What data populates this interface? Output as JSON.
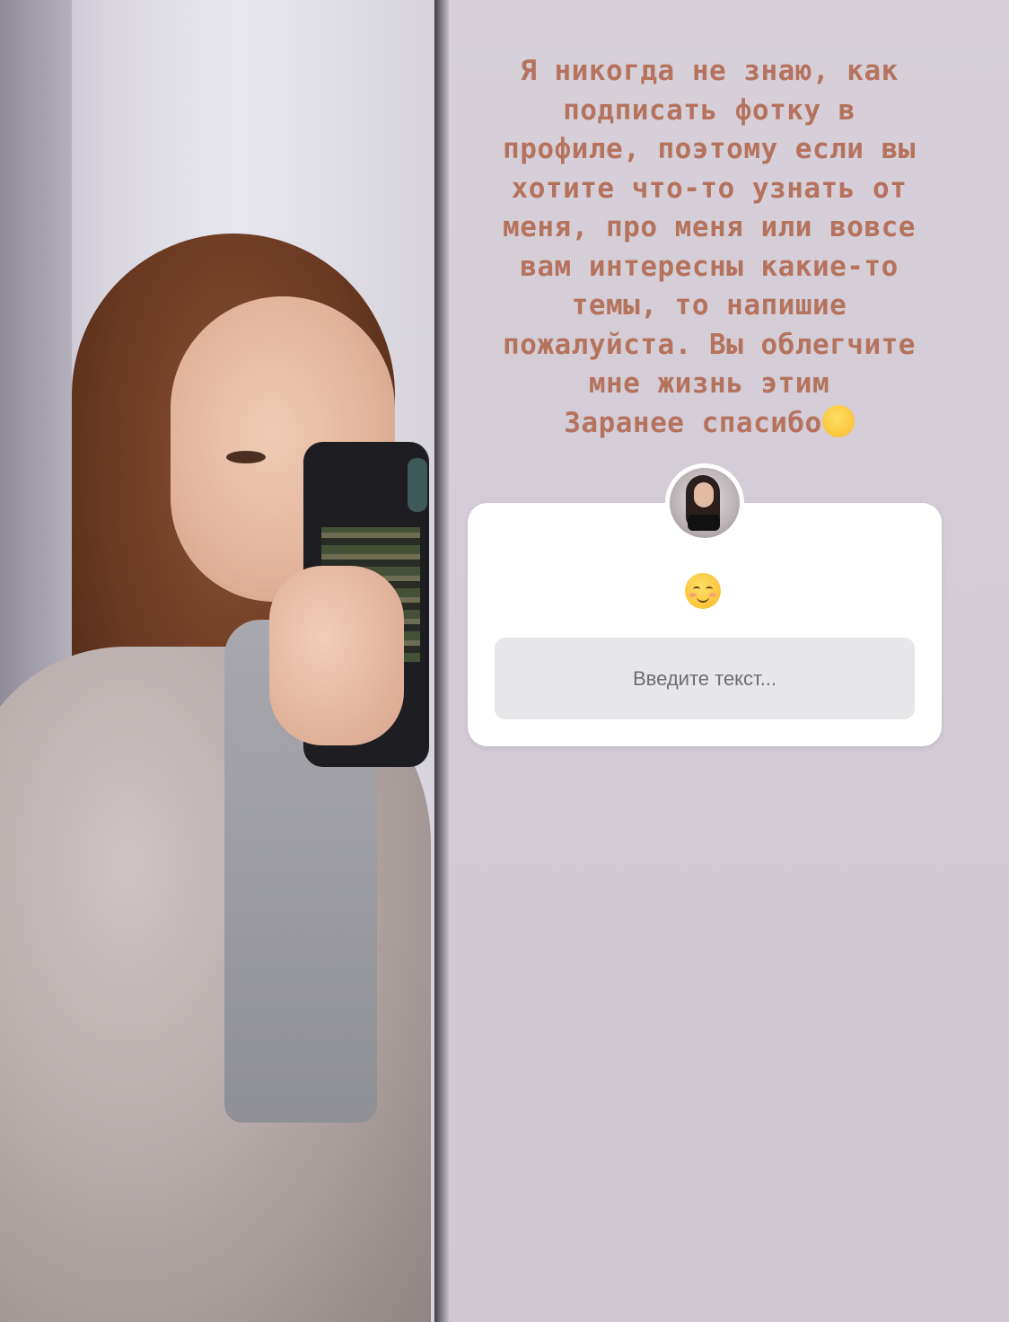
{
  "story": {
    "lines": "Я никогда не знаю, как\nподписать фотку в\nпрофиле, поэтому если вы\nхотите что-то узнать от\nменя, про меня или вовсе\nвам интересны какие-то\nтемы, то напишие\nпожалуйста. Вы облегчите\nмне жизнь этим\nЗаранее спасибо",
    "text_color": "#b5735e"
  },
  "question_sticker": {
    "emoji": "smiling-face-icon",
    "input_placeholder": "Введите текст..."
  },
  "photo": {
    "icon": "mirror-selfie-photo"
  }
}
